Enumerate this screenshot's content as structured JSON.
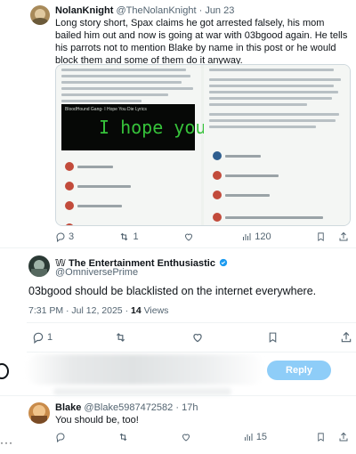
{
  "post1": {
    "display_name": "NolanKnight",
    "handle": "@TheNolanKnight",
    "date": "Jun 23",
    "text": "Long story short, Spax claims he got arrested falsely, his mom bailed him out and now is going at war with 03bgood again. He tells his parrots not to mention Blake by name in this post or he would block them and some of them do it anyway.",
    "embedded_video_title": "BloodHound Gang- I Hope You Die Lyrics",
    "embedded_caption": "I hope you",
    "actions": {
      "replies": "3",
      "retweets": "1",
      "likes": "",
      "views": "120"
    }
  },
  "post2": {
    "display_name": "𝕎 The Entertainment Enthusiastic",
    "handle": "@OmniversePrime",
    "text": "03bgood should be blacklisted on the internet everywhere.",
    "time": "7:31 PM · Jul 12, 2025 ·",
    "views_count": "14",
    "views_label": "Views",
    "actions": {
      "replies": "1",
      "retweets": "",
      "likes": ""
    }
  },
  "reply_box": {
    "button_label": "Reply"
  },
  "post3": {
    "display_name": "Blake",
    "handle": "@Blake5987472582",
    "age": "17h",
    "text": "You should be, too!",
    "actions": {
      "replies": "",
      "retweets": "",
      "likes": "",
      "views": "15"
    }
  },
  "colors": {
    "accent": "#1d9bf0",
    "reply_button": "#8ecdf8",
    "muted": "#536471"
  }
}
